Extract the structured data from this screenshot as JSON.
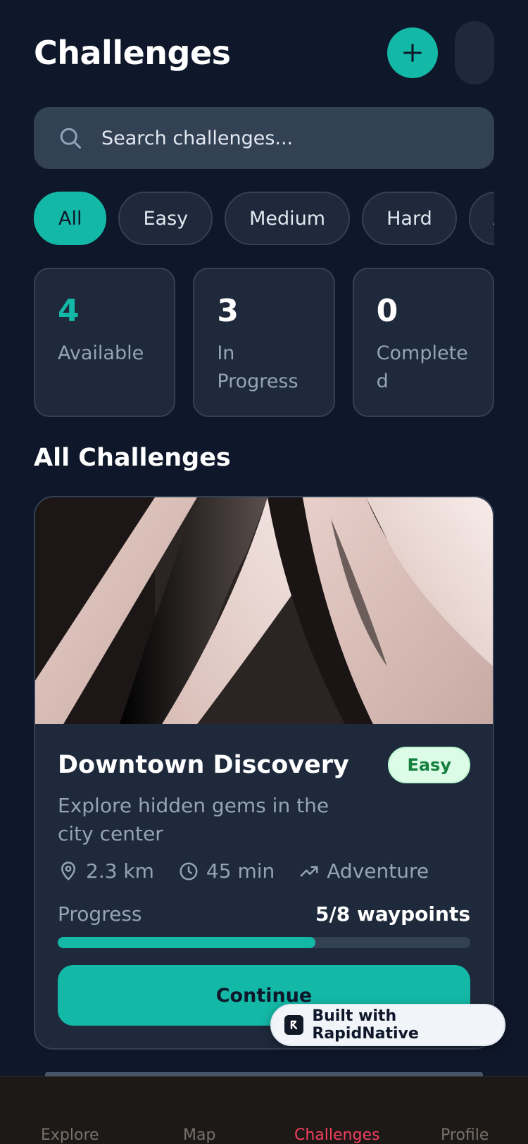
{
  "header": {
    "title": "Challenges"
  },
  "search": {
    "placeholder": "Search challenges..."
  },
  "filters": [
    "All",
    "Easy",
    "Medium",
    "Hard",
    "Adventure"
  ],
  "active_filter": "All",
  "stats": [
    {
      "value": "4",
      "label": "Available"
    },
    {
      "value": "3",
      "label": "In Progress"
    },
    {
      "value": "0",
      "label": "Completed"
    }
  ],
  "section": {
    "title": "All Challenges"
  },
  "challenge": {
    "title": "Downtown Discovery",
    "difficulty": "Easy",
    "description": "Explore hidden gems in the city center",
    "distance": "2.3 km",
    "duration": "45 min",
    "category": "Adventure",
    "progress_label": "Progress",
    "progress_text": "5/8 waypoints",
    "progress_fraction": 0.625,
    "button_label": "Continue"
  },
  "built_with": {
    "label": "Built with RapidNative"
  },
  "tabs": [
    "Explore",
    "Map",
    "Challenges",
    "Profile"
  ],
  "active_tab": "Challenges",
  "colors": {
    "accent": "#14b8a6",
    "background": "#0f172a",
    "card": "#1e293b",
    "badge_easy_bg": "#dcfce7",
    "badge_easy_text": "#15803d",
    "tab_active": "#f43f5e"
  },
  "icons": {
    "add": "plus-icon",
    "search": "search-icon",
    "distance": "map-pin-icon",
    "duration": "clock-icon",
    "category": "trending-up-icon"
  }
}
